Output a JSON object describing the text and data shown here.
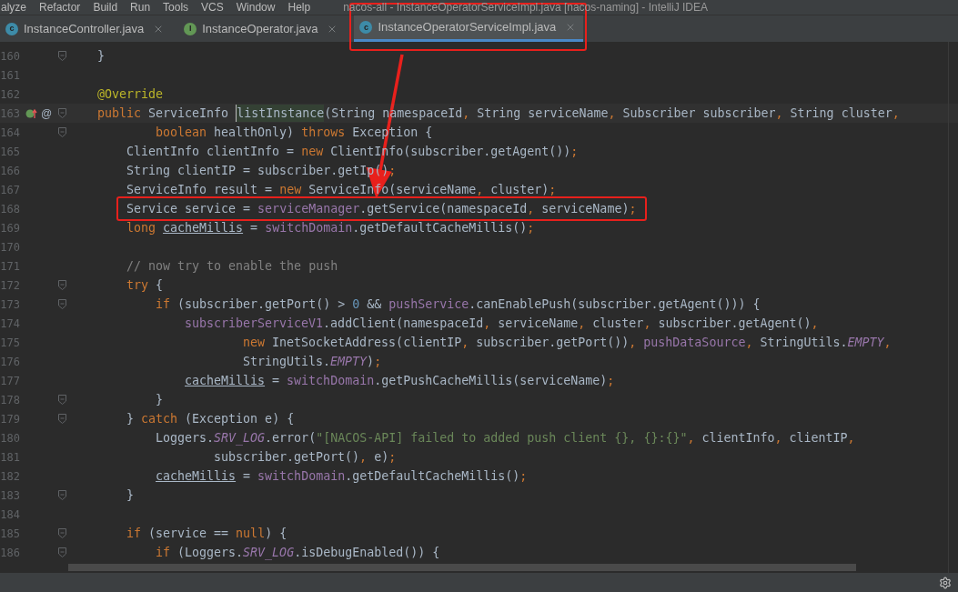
{
  "menu": [
    "alyze",
    "Refactor",
    "Build",
    "Run",
    "Tools",
    "VCS",
    "Window",
    "Help"
  ],
  "window": {
    "title": "nacos-all - InstanceOperatorServiceImpl.java [nacos-naming] - IntelliJ IDEA"
  },
  "tabs": [
    {
      "label": "InstanceController.java",
      "kind": "class",
      "badge": "c",
      "selected": false,
      "marked": false
    },
    {
      "label": "InstanceOperator.java",
      "kind": "interface",
      "badge": "I",
      "selected": false,
      "marked": false
    },
    {
      "label": "InstanceOperatorServiceImpl.java",
      "kind": "class",
      "badge": "c",
      "selected": true,
      "marked": true
    }
  ],
  "editor": {
    "lines": [
      {
        "number": "160",
        "fold": true,
        "tokens": [
          {
            "kind": "p",
            "text": "    }"
          }
        ]
      },
      {
        "number": "161"
      },
      {
        "number": "162",
        "tokens": [
          {
            "kind": "ann",
            "text": "    @Override"
          }
        ]
      },
      {
        "number": "163",
        "current": true,
        "fold": true,
        "gutter_mark": "@",
        "implements": true,
        "tokens": [
          {
            "kind": "kw",
            "text": "    public "
          },
          {
            "kind": "p",
            "text": "ServiceInfo "
          },
          {
            "kind": "hl",
            "text": "listInstance"
          },
          {
            "kind": "p",
            "text": "(String namespaceId"
          },
          {
            "kind": "kw",
            "text": ", "
          },
          {
            "kind": "p",
            "text": "String serviceName"
          },
          {
            "kind": "kw",
            "text": ", "
          },
          {
            "kind": "p",
            "text": "Subscriber subscriber"
          },
          {
            "kind": "kw",
            "text": ", "
          },
          {
            "kind": "p",
            "text": "String cluster"
          },
          {
            "kind": "kw",
            "text": ","
          }
        ]
      },
      {
        "number": "164",
        "fold": true,
        "tokens": [
          {
            "kind": "kw",
            "text": "            boolean "
          },
          {
            "kind": "p",
            "text": "healthOnly) "
          },
          {
            "kind": "kw",
            "text": "throws "
          },
          {
            "kind": "p",
            "text": "Exception {"
          }
        ]
      },
      {
        "number": "165",
        "tokens": [
          {
            "kind": "p",
            "text": "        ClientInfo clientInfo = "
          },
          {
            "kind": "kw",
            "text": "new "
          },
          {
            "kind": "p",
            "text": "ClientInfo(subscriber.getAgent())"
          },
          {
            "kind": "kw",
            "text": ";"
          }
        ]
      },
      {
        "number": "166",
        "tokens": [
          {
            "kind": "p",
            "text": "        String clientIP = subscriber.getIp()"
          },
          {
            "kind": "kw",
            "text": ";"
          }
        ]
      },
      {
        "number": "167",
        "tokens": [
          {
            "kind": "p",
            "text": "        ServiceInfo result = "
          },
          {
            "kind": "kw",
            "text": "new "
          },
          {
            "kind": "p",
            "text": "ServiceInfo(serviceName"
          },
          {
            "kind": "kw",
            "text": ", "
          },
          {
            "kind": "p",
            "text": "cluster)"
          },
          {
            "kind": "kw",
            "text": ";"
          }
        ]
      },
      {
        "number": "168",
        "marked": true,
        "tokens": [
          {
            "kind": "p",
            "text": "        Service service = "
          },
          {
            "kind": "f",
            "text": "serviceManager"
          },
          {
            "kind": "p",
            "text": ".getService(namespaceId"
          },
          {
            "kind": "kw",
            "text": ", "
          },
          {
            "kind": "p",
            "text": "serviceName)"
          },
          {
            "kind": "kw",
            "text": ";"
          }
        ]
      },
      {
        "number": "169",
        "tokens": [
          {
            "kind": "kw",
            "text": "        long "
          },
          {
            "kind": "u",
            "text": "cacheMillis"
          },
          {
            "kind": "p",
            "text": " = "
          },
          {
            "kind": "f",
            "text": "switchDomain"
          },
          {
            "kind": "p",
            "text": ".getDefaultCacheMillis()"
          },
          {
            "kind": "kw",
            "text": ";"
          }
        ]
      },
      {
        "number": "170"
      },
      {
        "number": "171",
        "tokens": [
          {
            "kind": "c",
            "text": "        // now try to enable the push"
          }
        ]
      },
      {
        "number": "172",
        "fold": true,
        "tokens": [
          {
            "kind": "kw",
            "text": "        try "
          },
          {
            "kind": "p",
            "text": "{"
          }
        ]
      },
      {
        "number": "173",
        "fold": true,
        "tokens": [
          {
            "kind": "kw",
            "text": "            if "
          },
          {
            "kind": "p",
            "text": "(subscriber.getPort() > "
          },
          {
            "kind": "n",
            "text": "0"
          },
          {
            "kind": "p",
            "text": " && "
          },
          {
            "kind": "f",
            "text": "pushService"
          },
          {
            "kind": "p",
            "text": ".canEnablePush(subscriber.getAgent())) {"
          }
        ]
      },
      {
        "number": "174",
        "tokens": [
          {
            "kind": "f",
            "text": "                subscriberServiceV1"
          },
          {
            "kind": "p",
            "text": ".addClient(namespaceId"
          },
          {
            "kind": "kw",
            "text": ", "
          },
          {
            "kind": "p",
            "text": "serviceName"
          },
          {
            "kind": "kw",
            "text": ", "
          },
          {
            "kind": "p",
            "text": "cluster"
          },
          {
            "kind": "kw",
            "text": ", "
          },
          {
            "kind": "p",
            "text": "subscriber.getAgent()"
          },
          {
            "kind": "kw",
            "text": ","
          }
        ]
      },
      {
        "number": "175",
        "tokens": [
          {
            "kind": "kw",
            "text": "                        new "
          },
          {
            "kind": "p",
            "text": "InetSocketAddress(clientIP"
          },
          {
            "kind": "kw",
            "text": ", "
          },
          {
            "kind": "p",
            "text": "subscriber.getPort())"
          },
          {
            "kind": "kw",
            "text": ", "
          },
          {
            "kind": "f",
            "text": "pushDataSource"
          },
          {
            "kind": "kw",
            "text": ", "
          },
          {
            "kind": "p",
            "text": "StringUtils."
          },
          {
            "kind": "s",
            "text": "EMPTY"
          },
          {
            "kind": "kw",
            "text": ","
          }
        ]
      },
      {
        "number": "176",
        "tokens": [
          {
            "kind": "p",
            "text": "                        StringUtils."
          },
          {
            "kind": "s",
            "text": "EMPTY"
          },
          {
            "kind": "p",
            "text": ")"
          },
          {
            "kind": "kw",
            "text": ";"
          }
        ]
      },
      {
        "number": "177",
        "tokens": [
          {
            "kind": "u",
            "text": "                cacheMillis"
          },
          {
            "kind": "p",
            "text": " = "
          },
          {
            "kind": "f",
            "text": "switchDomain"
          },
          {
            "kind": "p",
            "text": ".getPushCacheMillis(serviceName)"
          },
          {
            "kind": "kw",
            "text": ";"
          }
        ]
      },
      {
        "number": "178",
        "fold": true,
        "tokens": [
          {
            "kind": "p",
            "text": "            }"
          }
        ]
      },
      {
        "number": "179",
        "fold": true,
        "tokens": [
          {
            "kind": "p",
            "text": "        } "
          },
          {
            "kind": "kw",
            "text": "catch "
          },
          {
            "kind": "p",
            "text": "(Exception e) {"
          }
        ]
      },
      {
        "number": "180",
        "tokens": [
          {
            "kind": "p",
            "text": "            Loggers."
          },
          {
            "kind": "s",
            "text": "SRV_LOG"
          },
          {
            "kind": "p",
            "text": ".error("
          },
          {
            "kind": "str",
            "text": "\"[NACOS-API] failed to added push client {}, {}:{}\""
          },
          {
            "kind": "kw",
            "text": ", "
          },
          {
            "kind": "p",
            "text": "clientInfo"
          },
          {
            "kind": "kw",
            "text": ", "
          },
          {
            "kind": "p",
            "text": "clientIP"
          },
          {
            "kind": "kw",
            "text": ","
          }
        ]
      },
      {
        "number": "181",
        "tokens": [
          {
            "kind": "p",
            "text": "                    subscriber.getPort()"
          },
          {
            "kind": "kw",
            "text": ", "
          },
          {
            "kind": "p",
            "text": "e)"
          },
          {
            "kind": "kw",
            "text": ";"
          }
        ]
      },
      {
        "number": "182",
        "tokens": [
          {
            "kind": "u",
            "text": "            cacheMillis"
          },
          {
            "kind": "p",
            "text": " = "
          },
          {
            "kind": "f",
            "text": "switchDomain"
          },
          {
            "kind": "p",
            "text": ".getDefaultCacheMillis()"
          },
          {
            "kind": "kw",
            "text": ";"
          }
        ]
      },
      {
        "number": "183",
        "fold": true,
        "tokens": [
          {
            "kind": "p",
            "text": "        }"
          }
        ]
      },
      {
        "number": "184"
      },
      {
        "number": "185",
        "fold": true,
        "tokens": [
          {
            "kind": "kw",
            "text": "        if "
          },
          {
            "kind": "p",
            "text": "(service == "
          },
          {
            "kind": "kw",
            "text": "null"
          },
          {
            "kind": "p",
            "text": ") {"
          }
        ]
      },
      {
        "number": "186",
        "fold": true,
        "tokens": [
          {
            "kind": "kw",
            "text": "            if "
          },
          {
            "kind": "p",
            "text": "(Loggers."
          },
          {
            "kind": "s",
            "text": "SRV_LOG"
          },
          {
            "kind": "p",
            "text": ".isDebugEnabled()) {"
          }
        ]
      }
    ]
  }
}
